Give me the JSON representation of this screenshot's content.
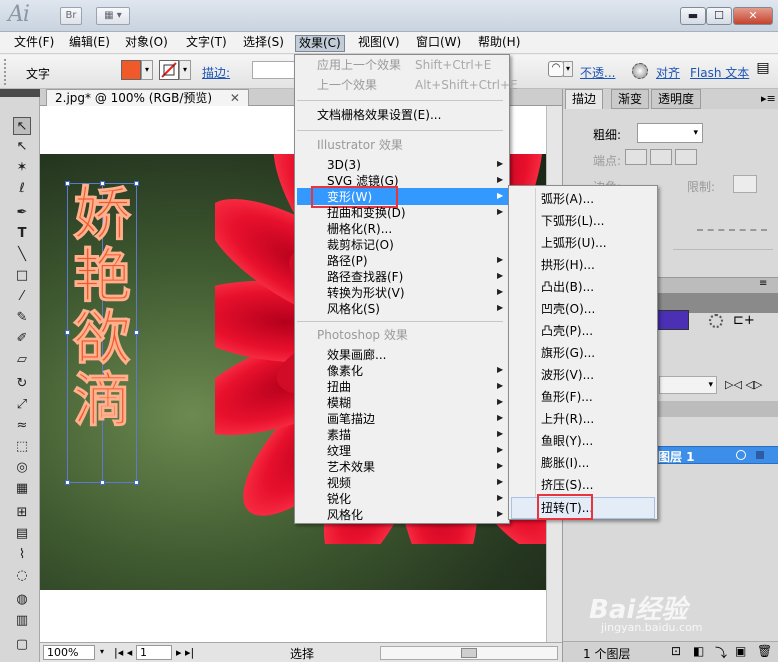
{
  "titlebar": {
    "app_logo": "Ai",
    "bridge_btn": "Br"
  },
  "menubar": {
    "items": [
      "文件(F)",
      "编辑(E)",
      "对象(O)",
      "文字(T)",
      "选择(S)",
      "效果(C)",
      "视图(V)",
      "窗口(W)",
      "帮助(H)"
    ]
  },
  "control_bar": {
    "tool_label": "文字",
    "stroke_label": "描边:",
    "opacity_label": "不透...",
    "align_label": "对齐",
    "flash_label": "Flash 文本"
  },
  "document": {
    "tab_label": "2.jpg* @ 100% (RGB/预览)",
    "text_vertical": [
      "娇",
      "艳",
      "欲",
      "滴"
    ]
  },
  "effects_menu": {
    "apply_last": "应用上一个效果",
    "apply_last_shortcut": "Shift+Ctrl+E",
    "last_effect": "上一个效果",
    "last_effect_shortcut": "Alt+Shift+Ctrl+E",
    "raster_settings": "文档栅格效果设置(E)...",
    "illustrator_header": "Illustrator 效果",
    "illustrator_items": [
      "3D(3)",
      "SVG 滤镜(G)",
      "变形(W)",
      "扭曲和变换(D)",
      "栅格化(R)...",
      "裁剪标记(O)",
      "路径(P)",
      "路径查找器(F)",
      "转换为形状(V)",
      "风格化(S)"
    ],
    "photoshop_header": "Photoshop 效果",
    "photoshop_items": [
      "效果画廊...",
      "像素化",
      "扭曲",
      "模糊",
      "画笔描边",
      "素描",
      "纹理",
      "艺术效果",
      "视频",
      "锐化",
      "风格化"
    ]
  },
  "warp_submenu": {
    "items": [
      "弧形(A)...",
      "下弧形(L)...",
      "上弧形(U)...",
      "拱形(H)...",
      "凸出(B)...",
      "凹壳(O)...",
      "凸壳(P)...",
      "旗形(G)...",
      "波形(V)...",
      "鱼形(F)...",
      "上升(R)...",
      "鱼眼(Y)...",
      "膨胀(I)...",
      "挤压(S)...",
      "扭转(T)..."
    ]
  },
  "right_panel": {
    "tabs": [
      "描边",
      "渐变",
      "透明度"
    ],
    "weight_label": "粗细:",
    "cap_label": "端点:",
    "corner_label": "边角:",
    "limit_label": "限制:",
    "layer_name": "图层 1",
    "layer_count": "1 个图层"
  },
  "status_bar": {
    "zoom": "100%",
    "page": "1",
    "mode": "选择"
  },
  "watermark": {
    "brand": "Bai经验",
    "url": "jingyan.baidu.com"
  },
  "colors": {
    "fill": "#f05a2a",
    "highlight": "#3d8ee8",
    "menu_sel": "#3399ff",
    "red_box": "#e8343a"
  }
}
